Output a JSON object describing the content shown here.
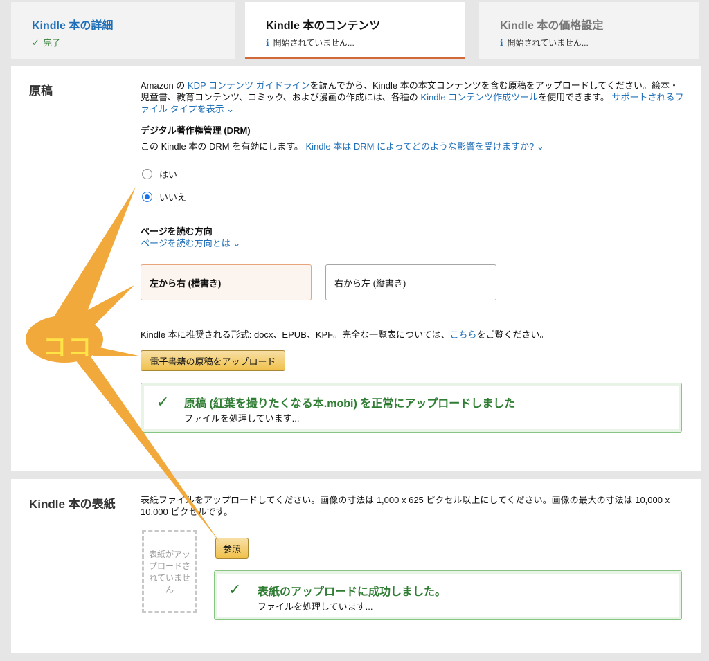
{
  "tabs": [
    {
      "title": "Kindle 本の詳細",
      "status": "完了",
      "icon": "check-icon"
    },
    {
      "title": "Kindle 本のコンテンツ",
      "status": "開始されていません...",
      "icon": "info-icon"
    },
    {
      "title": "Kindle 本の価格設定",
      "status": "開始されていません...",
      "icon": "info-icon"
    }
  ],
  "manuscript": {
    "title": "原稿",
    "intro_1": "Amazon の ",
    "intro_link_1": "KDP コンテンツ ガイドライン",
    "intro_2": "を読んでから、Kindle 本の本文コンテンツを含む原稿をアップロードしてください。絵本・児童書、教育コンテンツ、コミック、および漫画の作成には、各種の ",
    "intro_link_2": "Kindle コンテンツ作成ツール",
    "intro_3": "を使用できます。 ",
    "intro_link_3": "サポートされるファイル タイプを表示",
    "drm": {
      "heading": "デジタル著作権管理 (DRM)",
      "desc": "この Kindle 本の DRM を有効にします。 ",
      "link": "Kindle 本は DRM によってどのような影響を受けますか?",
      "options": [
        "はい",
        "いいえ"
      ],
      "selected": "いいえ"
    },
    "direction": {
      "heading": "ページを読む方向",
      "link": "ページを読む方向とは",
      "options": [
        "左から右 (横書き)",
        "右から左 (縦書き)"
      ],
      "selected": "左から右 (横書き)"
    },
    "formats_1": "Kindle 本に推奨される形式: docx、EPUB、KPF。完全な一覧表については、",
    "formats_link": "こちら",
    "formats_2": "をご覧ください。",
    "upload_button": "電子書籍の原稿をアップロード",
    "success_msg": "原稿 (紅葉を撮りたくなる本.mobi) を正常にアップロードしました",
    "success_sub": "ファイルを処理しています..."
  },
  "cover": {
    "title": "Kindle 本の表紙",
    "desc": "表紙ファイルをアップロードしてください。画像の寸法は 1,000 x 625 ピクセル以上にしてください。画像の最大の寸法は 10,000 x 10,000 ピクセルです。",
    "placeholder": "表紙がアップロードされていません",
    "browse_button": "参照",
    "success_msg": "表紙のアップロードに成功しました。",
    "success_sub": "ファイルを処理しています..."
  },
  "annotation": {
    "label": "ココ",
    "color": "#f2a93b",
    "label_color": "#ffe347"
  },
  "colors": {
    "link": "#1f6fb8",
    "success": "#2e7d32",
    "tab_active_underline": "#d0683a",
    "button_yellow": "#f0c14b",
    "radio_selected": "#1a73e8"
  }
}
